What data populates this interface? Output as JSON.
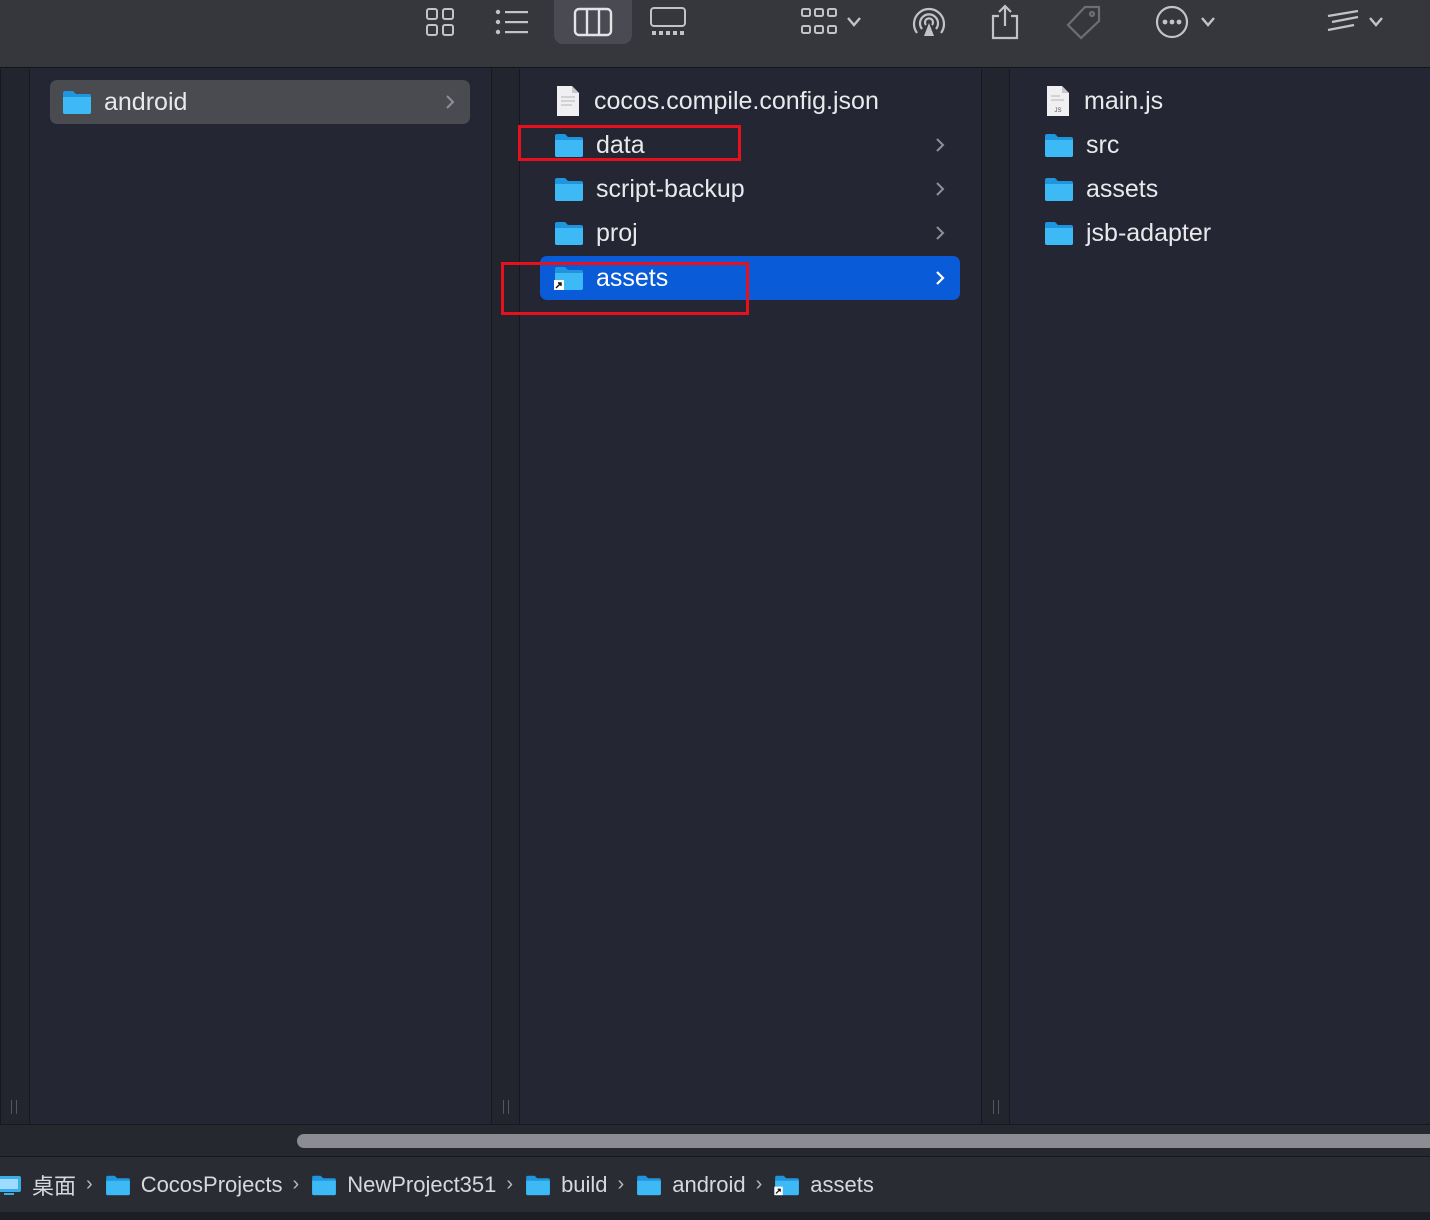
{
  "toolbar": {
    "buttons": [
      {
        "name": "icon-view-button",
        "icon": "grid-icon"
      },
      {
        "name": "list-view-button",
        "icon": "list-icon"
      },
      {
        "name": "column-view-button",
        "icon": "columns-icon",
        "active": true
      },
      {
        "name": "gallery-view-button",
        "icon": "gallery-icon"
      },
      {
        "name": "group-button",
        "icon": "group-grid-icon"
      },
      {
        "name": "airdrop-button",
        "icon": "airdrop-icon"
      },
      {
        "name": "share-button",
        "icon": "share-icon"
      },
      {
        "name": "tag-button",
        "icon": "tag-icon"
      },
      {
        "name": "more-actions-button",
        "icon": "ellipsis-circle-icon"
      },
      {
        "name": "toolbar-overflow-button",
        "icon": "overflow-icon"
      }
    ]
  },
  "columns": [
    {
      "items": [
        {
          "label": "android",
          "type": "folder",
          "has_children": true,
          "selected": "inactive"
        }
      ]
    },
    {
      "items": [
        {
          "label": "cocos.compile.config.json",
          "type": "file",
          "has_children": false
        },
        {
          "label": "data",
          "type": "folder",
          "has_children": true
        },
        {
          "label": "script-backup",
          "type": "folder",
          "has_children": true
        },
        {
          "label": "proj",
          "type": "folder",
          "has_children": true
        },
        {
          "label": "assets",
          "type": "folder-alias",
          "has_children": true,
          "selected": "active"
        }
      ]
    },
    {
      "items": [
        {
          "label": "main.js",
          "type": "js-file",
          "has_children": false
        },
        {
          "label": "src",
          "type": "folder",
          "has_children": false
        },
        {
          "label": "assets",
          "type": "folder",
          "has_children": false
        },
        {
          "label": "jsb-adapter",
          "type": "folder",
          "has_children": false
        }
      ]
    }
  ],
  "path_bar": [
    {
      "label": "桌面",
      "icon": "desktop-icon"
    },
    {
      "label": "CocosProjects",
      "icon": "folder-icon"
    },
    {
      "label": "NewProject351",
      "icon": "folder-icon"
    },
    {
      "label": "build",
      "icon": "folder-icon"
    },
    {
      "label": "android",
      "icon": "folder-icon"
    },
    {
      "label": "assets",
      "icon": "folder-alias-icon"
    }
  ],
  "colors": {
    "background": "#242733",
    "toolbar": "#36373d",
    "selection_active": "#0a5bd7",
    "selection_inactive": "#4a4b50",
    "folder_blue": "#38b6f5",
    "annotation_red": "#e8101c"
  }
}
